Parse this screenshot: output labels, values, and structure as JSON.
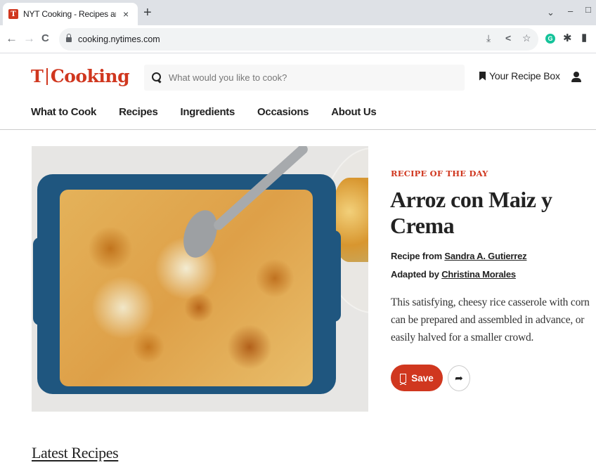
{
  "browser": {
    "tab_title": "NYT Cooking - Recipes and Cooking Guides",
    "favicon_glyph": "T",
    "close_icon": "×",
    "new_tab_icon": "+",
    "url": "cooking.nytimes.com",
    "nav": {
      "back": "←",
      "forward": "→",
      "reload": "C"
    },
    "window_controls": {
      "dropdown": "⌄",
      "minimize": "–",
      "maximize": "□"
    },
    "omnibox_icons": {
      "install": "⤓",
      "share": "<",
      "bookmark": "☆"
    },
    "extensions": {
      "grammarly": "G",
      "puzzle": "✱",
      "sidepanel": "▮"
    }
  },
  "site": {
    "logo_t": "𝕿",
    "logo_text": "Cooking",
    "search_placeholder": "What would you like to cook?",
    "recipe_box_label": "Your Recipe Box",
    "nav": [
      "What to Cook",
      "Recipes",
      "Ingredients",
      "Occasions",
      "About Us"
    ]
  },
  "hero": {
    "kicker": "RECIPE OF THE DAY",
    "title": "Arroz con Maiz y Crema",
    "recipe_from_label": "Recipe from",
    "recipe_from_author": "Sandra A. Gutierrez",
    "adapted_by_label": "Adapted by",
    "adapted_by_author": "Christina Morales",
    "description": "This satisfying, cheesy rice casserole with corn can be prepared and assembled in advance, or easily halved for a smaller crowd.",
    "save_label": "Save",
    "share_icon": "➦"
  },
  "section": {
    "latest_title": "Latest Recipes"
  },
  "colors": {
    "brand_red": "#d0371f",
    "text": "#222222",
    "dish_blue": "#1f567f"
  }
}
